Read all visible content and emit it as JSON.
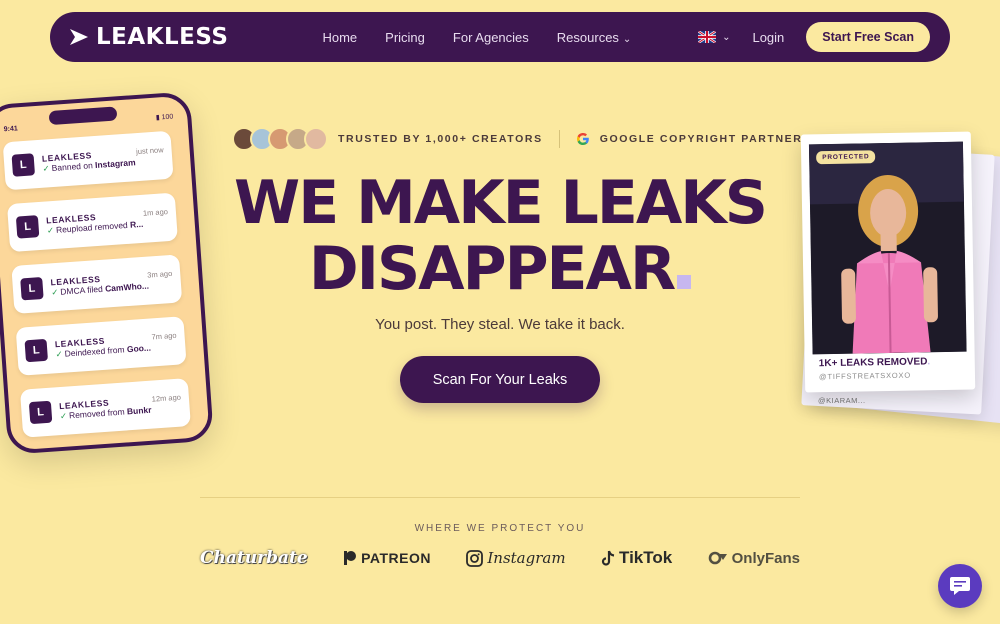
{
  "nav": {
    "logo_text": "LEAKLESS",
    "links": [
      {
        "label": "Home"
      },
      {
        "label": "Pricing"
      },
      {
        "label": "For Agencies"
      },
      {
        "label": "Resources"
      }
    ],
    "login_label": "Login",
    "cta_label": "Start Free Scan"
  },
  "trust": {
    "creators_text": "TRUSTED BY 1,000+ CREATORS",
    "partner_text": "GOOGLE COPYRIGHT PARTNER"
  },
  "hero": {
    "line1": "WE MAKE LEAKS",
    "line2": "DISAPPEAR",
    "subline": "You post. They steal. We take it back.",
    "cta_label": "Scan For Your Leaks"
  },
  "phone": {
    "time": "9:41",
    "battery": "100",
    "notifications": [
      {
        "title": "LEAKLESS",
        "time": "just now",
        "msg_prefix": "Banned on ",
        "msg_bold": "Instagram"
      },
      {
        "title": "LEAKLESS",
        "time": "1m ago",
        "msg_prefix": "Reupload removed ",
        "msg_bold": "R..."
      },
      {
        "title": "LEAKLESS",
        "time": "3m ago",
        "msg_prefix": "DMCA filed ",
        "msg_bold": "CamWho..."
      },
      {
        "title": "LEAKLESS",
        "time": "7m ago",
        "msg_prefix": "Deindexed from ",
        "msg_bold": "Goo..."
      },
      {
        "title": "LEAKLESS",
        "time": "12m ago",
        "msg_prefix": "Removed from ",
        "msg_bold": "Bunkr"
      }
    ]
  },
  "polaroid": {
    "badge": "PROTECTED",
    "caption": "1K+ LEAKS REMOVED",
    "handle": "@TIFFSTREATSXOXO",
    "back_handle": "@KIARAM..."
  },
  "platforms": {
    "label": "WHERE WE PROTECT YOU",
    "brands": [
      "Chaturbate",
      "PATREON",
      "Instagram",
      "TikTok",
      "OnlyFans"
    ]
  },
  "colors": {
    "background": "#fbe9a0",
    "primary": "#3d1650",
    "accent": "#c7b7f0",
    "chat": "#5b3bbf"
  }
}
